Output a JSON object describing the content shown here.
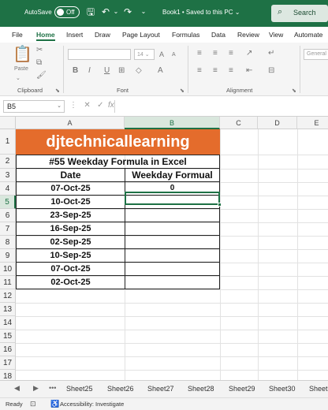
{
  "titlebar": {
    "autosave_label": "AutoSave",
    "autosave_state": "Off",
    "document": "Book1 • Saved to this PC ⌄",
    "search_label": "Search"
  },
  "ribbon_tabs": [
    "File",
    "Home",
    "Insert",
    "Draw",
    "Page Layout",
    "Formulas",
    "Data",
    "Review",
    "View",
    "Automate"
  ],
  "ribbon": {
    "groups": [
      "Clipboard",
      "Font",
      "Alignment"
    ],
    "paste_label": "Paste",
    "font_size": "14",
    "number_format": "General"
  },
  "formula_bar": {
    "name_box": "B5",
    "fx": "fx",
    "formula": ""
  },
  "grid": {
    "columns": [
      "A",
      "B",
      "C",
      "D",
      "E"
    ],
    "rows": [
      "1",
      "2",
      "3",
      "4",
      "5",
      "6",
      "7",
      "8",
      "9",
      "10",
      "11",
      "12",
      "13",
      "14",
      "15",
      "16",
      "17",
      "18"
    ],
    "banner": "djtechnicallearning",
    "subtitle": "#55 Weekday Formula in Excel",
    "header_date": "Date",
    "header_weekday": "Weekday Formual",
    "dates": [
      "07-Oct-25",
      "10-Oct-25",
      "23-Sep-25",
      "16-Sep-25",
      "02-Sep-25",
      "10-Sep-25",
      "07-Oct-25",
      "02-Oct-25"
    ],
    "weekday_b4": "0"
  },
  "sheet_tabs": [
    "Sheet25",
    "Sheet26",
    "Sheet27",
    "Sheet28",
    "Sheet29",
    "Sheet30",
    "Sheet"
  ],
  "status": {
    "ready": "Ready",
    "accessibility": "Accessibility: Investigate"
  },
  "colors": {
    "accent": "#1e7145",
    "banner": "#e46c2c"
  }
}
